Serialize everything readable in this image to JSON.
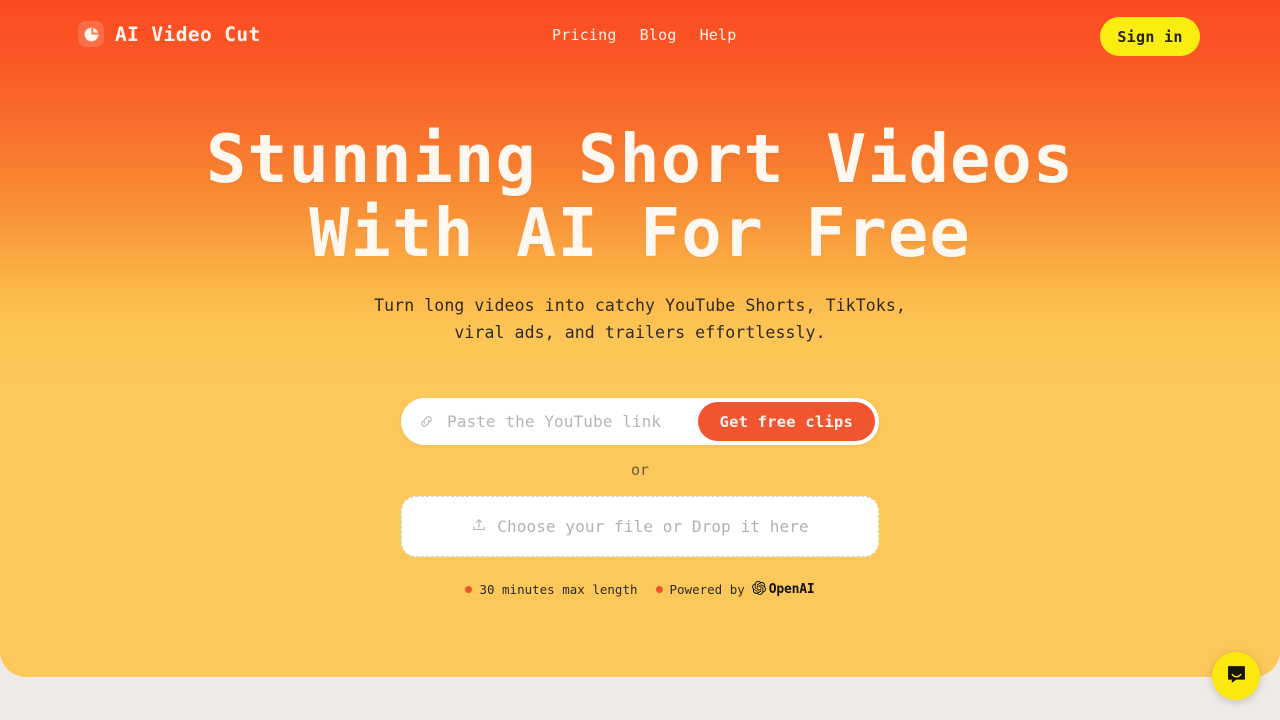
{
  "nav": {
    "logo_icon": "pie-circle-logo-icon",
    "brand": "AI Video Cut",
    "links": [
      {
        "label": "Pricing"
      },
      {
        "label": "Blog"
      },
      {
        "label": "Help"
      }
    ],
    "signin_label": "Sign in"
  },
  "hero": {
    "headline_line1": "Stunning Short Videos",
    "headline_line2": "With AI For Free",
    "subhead_line1": "Turn long videos into catchy YouTube Shorts, TikToks,",
    "subhead_line2": "viral ads, and trailers effortlessly."
  },
  "url_form": {
    "link_icon": "chain-link-icon",
    "input_value": "",
    "placeholder": "Paste the YouTube link",
    "cta_label": "Get free clips"
  },
  "divider": {
    "label": "or"
  },
  "dropzone": {
    "upload_icon": "upload-tray-icon",
    "label": "Choose your file or Drop it here"
  },
  "badges": [
    {
      "dot_color": "#F0522A",
      "text": "30 minutes max length"
    },
    {
      "dot_color": "#F0522A",
      "text": "Powered by",
      "brand": "OpenAI",
      "brand_icon": "openai-logo-icon"
    }
  ],
  "chat_widget": {
    "icon": "chat-bubble-smile-icon"
  },
  "colors": {
    "gradient_top": "#FB4A22",
    "gradient_bottom": "#FCC85A",
    "accent_button": "#F1552F",
    "signin_yellow": "#FAEE10",
    "page_background": "#EEEAE6",
    "chat_yellow": "#FAE80F"
  }
}
